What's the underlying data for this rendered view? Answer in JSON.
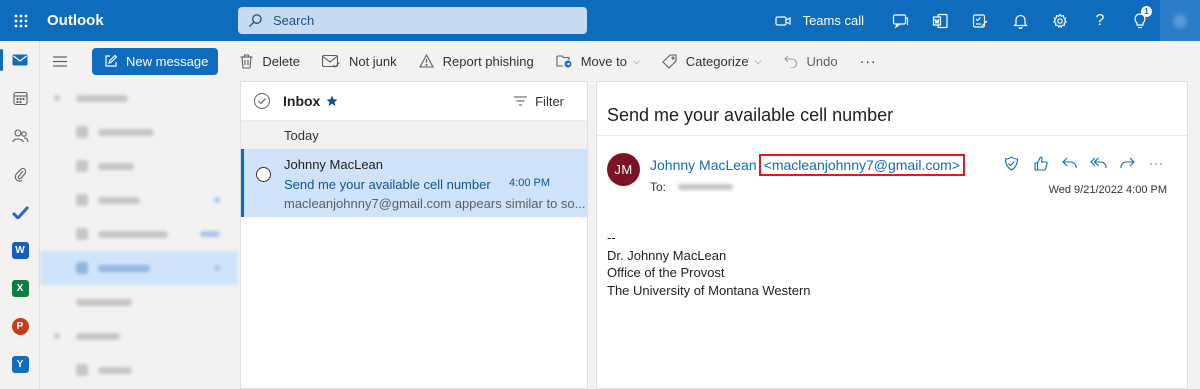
{
  "topbar": {
    "app_name": "Outlook",
    "search_placeholder": "Search",
    "teams_call": "Teams call",
    "tips_badge": "1"
  },
  "commands": {
    "new_message": "New message",
    "delete": "Delete",
    "not_junk": "Not junk",
    "report_phishing": "Report phishing",
    "move_to": "Move to",
    "categorize": "Categorize",
    "undo": "Undo",
    "more": "···"
  },
  "message_list": {
    "folder": "Inbox",
    "filter": "Filter",
    "group": "Today",
    "messages": [
      {
        "from": "Johnny MacLean",
        "subject": "Send me your available cell number",
        "time": "4:00 PM",
        "preview": "macleanjohnny7@gmail.com appears similar to so..."
      }
    ]
  },
  "reading": {
    "subject": "Send me your available cell number",
    "avatar_initials": "JM",
    "sender_name": "Johnny MacLean",
    "sender_address": "<macleanjohnny7@gmail.com>",
    "to_label": "To:",
    "date": "Wed 9/21/2022 4:00 PM",
    "body_lines": [
      "--",
      "Dr. Johnny MacLean",
      "Office of the Provost",
      "The University of Montana Western"
    ]
  },
  "colors": {
    "brand": "#0f6cbd",
    "selected": "#cfe4fa",
    "avatar": "#7a1425",
    "highlight": "#e8171f"
  }
}
